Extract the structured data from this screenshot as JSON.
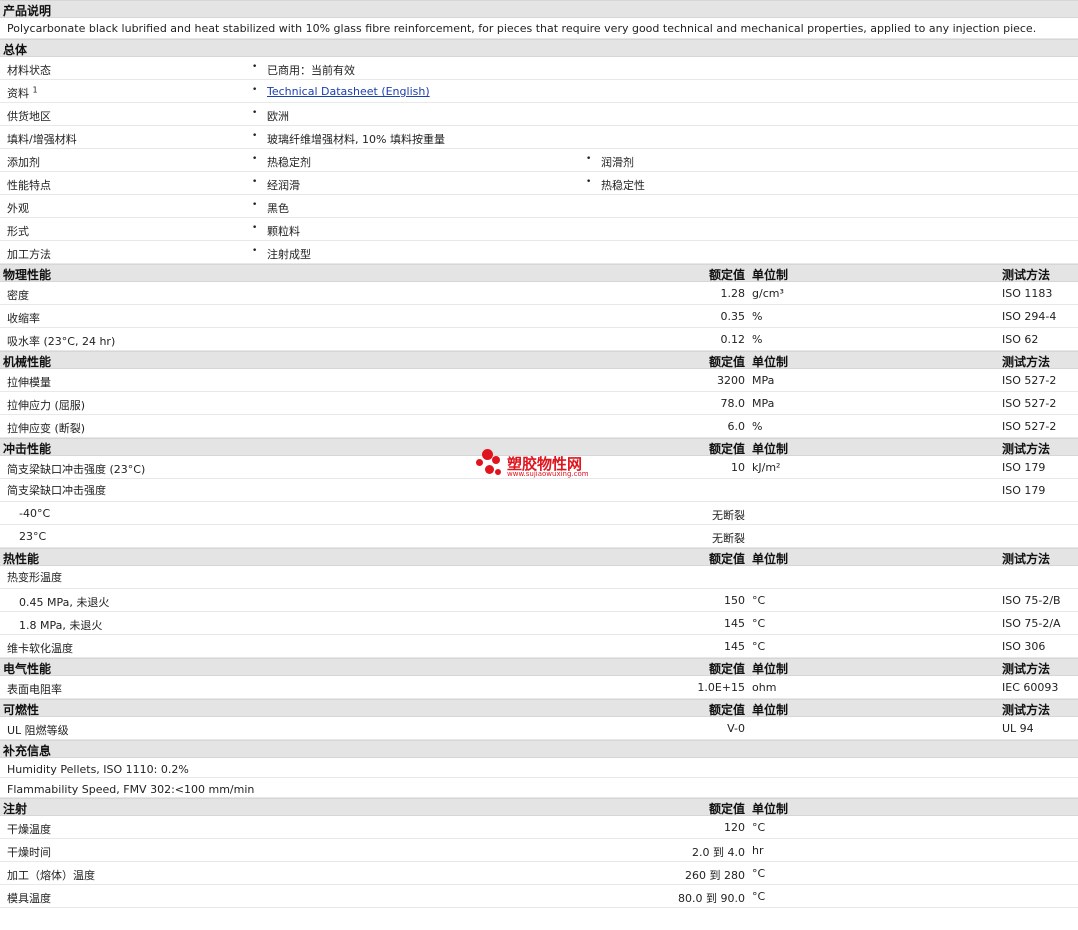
{
  "sections": {
    "desc_title": "产品说明",
    "description": "Polycarbonate black lubrified and heat stabilized with 10% glass fibre reinforcement, for pieces that require very good technical and mechanical properties, applied to any injection piece.",
    "general": "总体",
    "physical": "物理性能",
    "mechanical": "机械性能",
    "impact": "冲击性能",
    "thermal": "热性能",
    "electrical": "电气性能",
    "flammability": "可燃性",
    "supplemental": "补充信息",
    "injection": "注射"
  },
  "headers": {
    "nominal": "额定值",
    "unit": "单位制",
    "test": "测试方法"
  },
  "general": {
    "status_label": "材料状态",
    "status_value": "已商用：当前有效",
    "docs_label": "资料",
    "docs_sup": "1",
    "docs_link": "Technical Datasheet (English)",
    "region_label": "供货地区",
    "region_value": "欧洲",
    "filler_label": "填料/增强材料",
    "filler_value": "玻璃纤维增强材料, 10% 填料按重量",
    "additive_label": "添加剂",
    "additive_1": "热稳定剂",
    "additive_2": "润滑剂",
    "features_label": "性能特点",
    "features_1": "经润滑",
    "features_2": "热稳定性",
    "appearance_label": "外观",
    "appearance_value": "黑色",
    "form_label": "形式",
    "form_value": "颗粒料",
    "process_label": "加工方法",
    "process_value": "注射成型",
    "bullet": "•"
  },
  "physical": [
    {
      "label": "密度",
      "value": "1.28",
      "unit": "g/cm³",
      "test": "ISO 1183"
    },
    {
      "label": "收缩率",
      "value": "0.35",
      "unit": "%",
      "test": "ISO 294-4"
    },
    {
      "label": "吸水率 (23°C, 24 hr)",
      "value": "0.12",
      "unit": "%",
      "test": "ISO 62"
    }
  ],
  "mechanical": [
    {
      "label": "拉伸模量",
      "value": "3200",
      "unit": "MPa",
      "test": "ISO 527-2"
    },
    {
      "label": "拉伸应力 (屈服)",
      "value": "78.0",
      "unit": "MPa",
      "test": "ISO 527-2"
    },
    {
      "label": "拉伸应变 (断裂)",
      "value": "6.0",
      "unit": "%",
      "test": "ISO 527-2"
    }
  ],
  "impact": {
    "r1_label": "简支梁缺口冲击强度 (23°C)",
    "r1_value": "10",
    "r1_unit": "kJ/m²",
    "r1_test": "ISO 179",
    "r2_label": "简支梁缺口冲击强度",
    "r2_test": "ISO 179",
    "r3_label": "-40°C",
    "r3_value": "无断裂",
    "r4_label": "23°C",
    "r4_value": "无断裂"
  },
  "thermal": {
    "r1_label": "热变形温度",
    "r2_label": "0.45 MPa, 未退火",
    "r2_value": "150",
    "r2_unit": "°C",
    "r2_test": "ISO 75-2/B",
    "r3_label": "1.8 MPa, 未退火",
    "r3_value": "145",
    "r3_unit": "°C",
    "r3_test": "ISO 75-2/A",
    "r4_label": "维卡软化温度",
    "r4_value": "145",
    "r4_unit": "°C",
    "r4_test": "ISO 306"
  },
  "electrical": {
    "label": "表面电阻率",
    "value": "1.0E+15",
    "unit": "ohm",
    "test": "IEC 60093"
  },
  "flammability": {
    "label": "UL 阻燃等级",
    "value": "V-0",
    "test": "UL 94"
  },
  "supplemental": {
    "line1": "Humidity Pellets, ISO 1110: 0.2%",
    "line2": "Flammability Speed, FMV 302:<100 mm/min"
  },
  "injection": [
    {
      "label": "干燥温度",
      "value": "120",
      "unit": "°C"
    },
    {
      "label": "干燥时间",
      "value": "2.0 到  4.0",
      "unit": "hr"
    },
    {
      "label": "加工（熔体）温度",
      "value": "260 到  280",
      "unit": "°C"
    },
    {
      "label": "模具温度",
      "value": "80.0 到  90.0",
      "unit": "°C"
    }
  ],
  "watermark": {
    "name": "塑胶物性网",
    "url": "www.sujiaowuxing.com",
    "color": "#e0141e"
  }
}
